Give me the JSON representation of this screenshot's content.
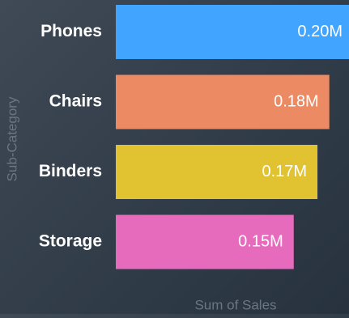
{
  "chart_data": {
    "type": "bar",
    "orientation": "horizontal",
    "categories": [
      "Phones",
      "Chairs",
      "Binders",
      "Storage"
    ],
    "values": [
      0.2,
      0.18,
      0.17,
      0.15
    ],
    "value_unit": "M",
    "data_labels": [
      "0.20M",
      "0.18M",
      "0.17M",
      "0.15M"
    ],
    "bar_colors": [
      "#41a5ff",
      "#ec8b63",
      "#e1c230",
      "#e66bbd"
    ],
    "xlabel": "Sum of Sales",
    "ylabel": "Sub-Category",
    "grid": false,
    "legend": "none"
  }
}
